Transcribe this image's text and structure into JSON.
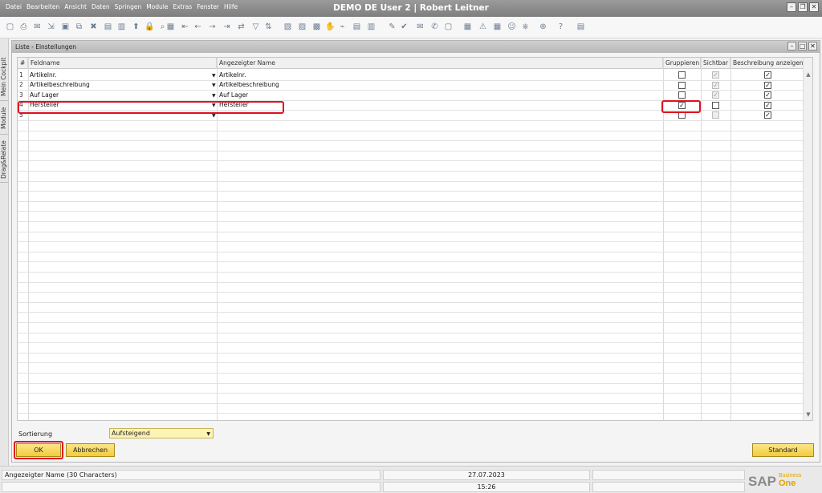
{
  "app": {
    "title": "DEMO DE User 2 | Robert Leitner",
    "menu": [
      "Datei",
      "Bearbeiten",
      "Ansicht",
      "Daten",
      "Springen",
      "Module",
      "Extras",
      "Fenster",
      "Hilfe"
    ]
  },
  "sidetabs": [
    "Mein Cockpit",
    "Module",
    "Drag&Relate"
  ],
  "window": {
    "title": "Liste - Einstellungen"
  },
  "grid": {
    "columns": [
      "#",
      "Feldname",
      "Angezeigter Name",
      "Gruppieren",
      "Sichtbar",
      "Beschreibung anzeigen"
    ],
    "rows": [
      {
        "num": "1",
        "field": "Artikelnr.",
        "display": "Artikelnr.",
        "group": false,
        "visible": true,
        "visible_disabled": true,
        "desc": true
      },
      {
        "num": "2",
        "field": "Artikelbeschreibung",
        "display": "Artikelbeschreibung",
        "group": false,
        "visible": true,
        "visible_disabled": true,
        "desc": true
      },
      {
        "num": "3",
        "field": "Auf Lager",
        "display": "Auf Lager",
        "group": false,
        "visible": true,
        "visible_disabled": true,
        "desc": true
      },
      {
        "num": "4",
        "field": "Hersteller",
        "display": "Hersteller",
        "group": true,
        "visible": false,
        "visible_disabled": false,
        "desc": true
      },
      {
        "num": "5",
        "field": "",
        "display": "",
        "group": false,
        "visible": false,
        "visible_disabled": true,
        "desc": true
      }
    ]
  },
  "sort": {
    "label": "Sortierung",
    "value": "Aufsteigend"
  },
  "buttons": {
    "ok": "OK",
    "cancel": "Abbrechen",
    "standard": "Standard"
  },
  "status": {
    "message": "Angezeigter Name (30 Characters)",
    "date": "27.07.2023",
    "time": "15:26"
  },
  "logo": {
    "brand": "SAP",
    "product_top": "Business",
    "product": "One"
  },
  "colors": {
    "highlight": "#e1101f",
    "button": "#f5d35a",
    "dropdown": "#fdf4b3"
  }
}
